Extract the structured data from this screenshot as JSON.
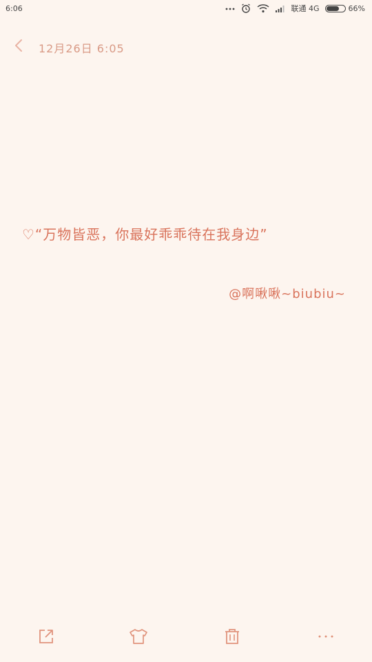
{
  "status_bar": {
    "time": "6:06",
    "carrier": "联通 4G",
    "battery_text": "66%",
    "battery_level": 0.66
  },
  "header": {
    "date": "12月26日 6:05"
  },
  "note": {
    "text": "♡“万物皆恶，你最好乖乖待在我身边”",
    "signature": "@啊啾啾~biubiu~"
  },
  "toolbar": {
    "icons": [
      "share-icon",
      "theme-shirt-icon",
      "trash-icon",
      "more-icon"
    ]
  },
  "colors": {
    "background": "#fdf5ef",
    "accent": "#d9735b",
    "icon": "#e0937c"
  }
}
